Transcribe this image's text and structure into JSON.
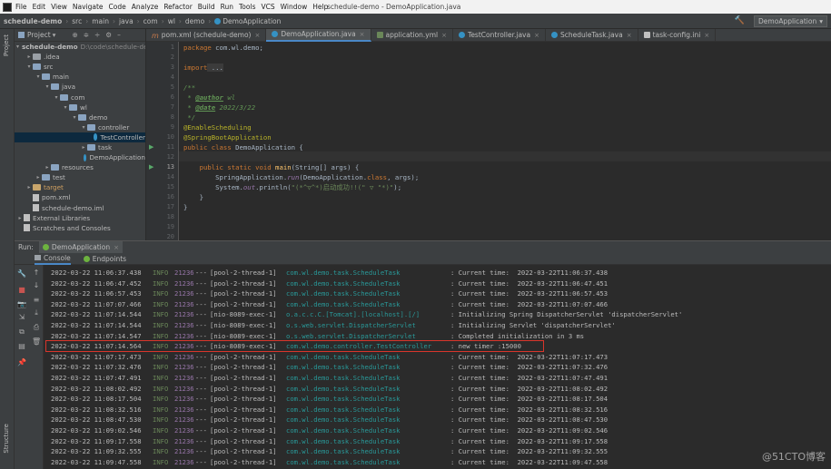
{
  "menubar": {
    "items": [
      "File",
      "Edit",
      "View",
      "Navigate",
      "Code",
      "Analyze",
      "Refactor",
      "Build",
      "Run",
      "Tools",
      "VCS",
      "Window",
      "Help"
    ],
    "window_title": "schedule-demo - DemoApplication.java"
  },
  "navbar": {
    "crumbs": [
      "schedule-demo",
      "src",
      "main",
      "java",
      "com",
      "wl",
      "demo",
      "DemoApplication"
    ],
    "run_config": "DemoApplication"
  },
  "left_stripe": {
    "project": "Project",
    "structure": "Structure"
  },
  "project_panel": {
    "title": "Project",
    "tree": [
      {
        "label": "schedule-demo",
        "extra": "D:\\code\\schedule-de",
        "indent": 0,
        "arrow": "▾",
        "icon": "folder"
      },
      {
        "label": ".idea",
        "indent": 1,
        "arrow": "▸",
        "icon": "folder-gray"
      },
      {
        "label": "src",
        "indent": 1,
        "arrow": "▾",
        "icon": "folder"
      },
      {
        "label": "main",
        "indent": 2,
        "arrow": "▾",
        "icon": "folder"
      },
      {
        "label": "java",
        "indent": 3,
        "arrow": "▾",
        "icon": "folder"
      },
      {
        "label": "com",
        "indent": 4,
        "arrow": "▾",
        "icon": "folder"
      },
      {
        "label": "wl",
        "indent": 5,
        "arrow": "▾",
        "icon": "folder"
      },
      {
        "label": "demo",
        "indent": 6,
        "arrow": "▾",
        "icon": "folder"
      },
      {
        "label": "controller",
        "indent": 7,
        "arrow": "▾",
        "icon": "folder"
      },
      {
        "label": "TestController",
        "indent": 8,
        "arrow": "",
        "icon": "class",
        "selected": true
      },
      {
        "label": "task",
        "indent": 7,
        "arrow": "▸",
        "icon": "folder"
      },
      {
        "label": "DemoApplication",
        "indent": 7,
        "arrow": "",
        "icon": "class"
      },
      {
        "label": "resources",
        "indent": 3,
        "arrow": "▸",
        "icon": "folder"
      },
      {
        "label": "test",
        "indent": 2,
        "arrow": "▸",
        "icon": "folder"
      },
      {
        "label": "target",
        "indent": 1,
        "arrow": "▸",
        "icon": "folder-orange"
      },
      {
        "label": "pom.xml",
        "indent": 1,
        "arrow": "",
        "icon": "file"
      },
      {
        "label": "schedule-demo.iml",
        "indent": 1,
        "arrow": "",
        "icon": "file"
      },
      {
        "label": "External Libraries",
        "indent": 0,
        "arrow": "▸",
        "icon": "file"
      },
      {
        "label": "Scratches and Consoles",
        "indent": 0,
        "arrow": "",
        "icon": "file"
      }
    ]
  },
  "editor_tabs": [
    {
      "label": "pom.xml (schedule-demo)",
      "icon": "m",
      "active": false
    },
    {
      "label": "DemoApplication.java",
      "icon": "class",
      "active": true
    },
    {
      "label": "application.yml",
      "icon": "yml",
      "active": false
    },
    {
      "label": "TestController.java",
      "icon": "class",
      "active": false
    },
    {
      "label": "ScheduleTask.java",
      "icon": "class",
      "active": false
    },
    {
      "label": "task-config.ini",
      "icon": "file",
      "active": false
    }
  ],
  "editor": {
    "line_numbers": [
      "1",
      "2",
      "3",
      "4",
      "5",
      "6",
      "7",
      "8",
      "9",
      "10",
      "11",
      "12",
      "13",
      "14",
      "15",
      "16",
      "17",
      "18",
      "19",
      "20"
    ],
    "current_line": "13",
    "code": {
      "l1_kw": "package",
      "l1_rest": " com.wl.demo;",
      "l3_kw": "import",
      "l3_rest": " ...",
      "l5": "/**",
      "l6_pre": " * ",
      "l6_tag": "@author",
      "l6_rest": " wl",
      "l7_pre": " * ",
      "l7_tag": "@date",
      "l7_rest": " 2022/3/22",
      "l8": " */",
      "l9": "@EnableScheduling",
      "l10": "@SpringBootApplication",
      "l11_kw": "public class",
      "l11_rest": " DemoApplication {",
      "l13_kw": "    public static void",
      "l13_fn": " main",
      "l13_rest": "(String[] args) {",
      "l14_pre": "        SpringApplication.",
      "l14_fn": "run",
      "l14_rest": "(DemoApplication.",
      "l14_kw": "class",
      "l14_end": ", args);",
      "l15_pre": "        System.",
      "l15_stat": "out",
      "l15_mid": ".println(",
      "l15_str": "\"(*^▽^*)启动成功!!(\" ▽ \"*)\"",
      "l15_end": ");",
      "l16": "    }",
      "l17": "}"
    }
  },
  "run_panel": {
    "label": "Run:",
    "config_tab": "DemoApplication",
    "tabs": [
      "Console",
      "Endpoints"
    ]
  },
  "log_rows": [
    {
      "ts": "2022-03-22 11:06:37.438",
      "level": "INFO",
      "pid": "21236",
      "sep": "---",
      "thread": "[pool-2-thread-1]",
      "logger": "com.wl.demo.task.ScheduleTask",
      "msg": ": Current time:  2022-03-22T11:06:37.438"
    },
    {
      "ts": "2022-03-22 11:06:47.452",
      "level": "INFO",
      "pid": "21236",
      "sep": "---",
      "thread": "[pool-2-thread-1]",
      "logger": "com.wl.demo.task.ScheduleTask",
      "msg": ": Current time:  2022-03-22T11:06:47.451"
    },
    {
      "ts": "2022-03-22 11:06:57.453",
      "level": "INFO",
      "pid": "21236",
      "sep": "---",
      "thread": "[pool-2-thread-1]",
      "logger": "com.wl.demo.task.ScheduleTask",
      "msg": ": Current time:  2022-03-22T11:06:57.453"
    },
    {
      "ts": "2022-03-22 11:07:07.466",
      "level": "INFO",
      "pid": "21236",
      "sep": "---",
      "thread": "[pool-2-thread-1]",
      "logger": "com.wl.demo.task.ScheduleTask",
      "msg": ": Current time:  2022-03-22T11:07:07.466"
    },
    {
      "ts": "2022-03-22 11:07:14.544",
      "level": "INFO",
      "pid": "21236",
      "sep": "---",
      "thread": "[nio-8089-exec-1]",
      "logger": "o.a.c.c.C.[Tomcat].[localhost].[/]",
      "msg": ": Initializing Spring DispatcherServlet 'dispatcherServlet'"
    },
    {
      "ts": "2022-03-22 11:07:14.544",
      "level": "INFO",
      "pid": "21236",
      "sep": "---",
      "thread": "[nio-8089-exec-1]",
      "logger": "o.s.web.servlet.DispatcherServlet",
      "msg": ": Initializing Servlet 'dispatcherServlet'"
    },
    {
      "ts": "2022-03-22 11:07:14.547",
      "level": "INFO",
      "pid": "21236",
      "sep": "---",
      "thread": "[nio-8089-exec-1]",
      "logger": "o.s.web.servlet.DispatcherServlet",
      "msg": ": Completed initialization in 3 ms"
    },
    {
      "ts": "2022-03-22 11:07:14.564",
      "level": "INFO",
      "pid": "21236",
      "sep": "---",
      "thread": "[nio-8089-exec-1]",
      "logger": "com.wl.demo.controller.TestController",
      "msg": ": new timer :15000"
    },
    {
      "ts": "2022-03-22 11:07:17.473",
      "level": "INFO",
      "pid": "21236",
      "sep": "---",
      "thread": "[pool-2-thread-1]",
      "logger": "com.wl.demo.task.ScheduleTask",
      "msg": ": Current time:  2022-03-22T11:07:17.473"
    },
    {
      "ts": "2022-03-22 11:07:32.476",
      "level": "INFO",
      "pid": "21236",
      "sep": "---",
      "thread": "[pool-2-thread-1]",
      "logger": "com.wl.demo.task.ScheduleTask",
      "msg": ": Current time:  2022-03-22T11:07:32.476"
    },
    {
      "ts": "2022-03-22 11:07:47.491",
      "level": "INFO",
      "pid": "21236",
      "sep": "---",
      "thread": "[pool-2-thread-1]",
      "logger": "com.wl.demo.task.ScheduleTask",
      "msg": ": Current time:  2022-03-22T11:07:47.491"
    },
    {
      "ts": "2022-03-22 11:08:02.492",
      "level": "INFO",
      "pid": "21236",
      "sep": "---",
      "thread": "[pool-2-thread-1]",
      "logger": "com.wl.demo.task.ScheduleTask",
      "msg": ": Current time:  2022-03-22T11:08:02.492"
    },
    {
      "ts": "2022-03-22 11:08:17.504",
      "level": "INFO",
      "pid": "21236",
      "sep": "---",
      "thread": "[pool-2-thread-1]",
      "logger": "com.wl.demo.task.ScheduleTask",
      "msg": ": Current time:  2022-03-22T11:08:17.504"
    },
    {
      "ts": "2022-03-22 11:08:32.516",
      "level": "INFO",
      "pid": "21236",
      "sep": "---",
      "thread": "[pool-2-thread-1]",
      "logger": "com.wl.demo.task.ScheduleTask",
      "msg": ": Current time:  2022-03-22T11:08:32.516"
    },
    {
      "ts": "2022-03-22 11:08:47.530",
      "level": "INFO",
      "pid": "21236",
      "sep": "---",
      "thread": "[pool-2-thread-1]",
      "logger": "com.wl.demo.task.ScheduleTask",
      "msg": ": Current time:  2022-03-22T11:08:47.530"
    },
    {
      "ts": "2022-03-22 11:09:02.546",
      "level": "INFO",
      "pid": "21236",
      "sep": "---",
      "thread": "[pool-2-thread-1]",
      "logger": "com.wl.demo.task.ScheduleTask",
      "msg": ": Current time:  2022-03-22T11:09:02.546"
    },
    {
      "ts": "2022-03-22 11:09:17.558",
      "level": "INFO",
      "pid": "21236",
      "sep": "---",
      "thread": "[pool-2-thread-1]",
      "logger": "com.wl.demo.task.ScheduleTask",
      "msg": ": Current time:  2022-03-22T11:09:17.558"
    },
    {
      "ts": "2022-03-22 11:09:32.555",
      "level": "INFO",
      "pid": "21236",
      "sep": "---",
      "thread": "[pool-2-thread-1]",
      "logger": "com.wl.demo.task.ScheduleTask",
      "msg": ": Current time:  2022-03-22T11:09:32.555"
    },
    {
      "ts": "2022-03-22 11:09:47.558",
      "level": "INFO",
      "pid": "21236",
      "sep": "---",
      "thread": "[pool-2-thread-1]",
      "logger": "com.wl.demo.task.ScheduleTask",
      "msg": ": Current time:  2022-03-22T11:09:47.558"
    }
  ],
  "highlight_color": "#d9352b",
  "watermark": "@51CTO博客"
}
